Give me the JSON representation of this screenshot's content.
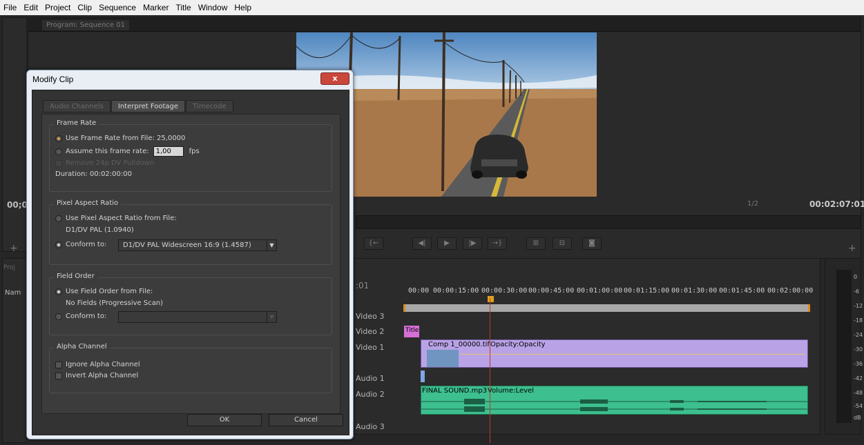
{
  "menu": [
    "File",
    "Edit",
    "Project",
    "Clip",
    "Sequence",
    "Marker",
    "Title",
    "Window",
    "Help"
  ],
  "program_monitor": {
    "tab_label": "Program: Sequence 01",
    "zoom": "1/2",
    "timecode": "00:02:07:01",
    "left_timecode": "00;0"
  },
  "timeline": {
    "playhead_timecode": ":01",
    "ruler": [
      "00:00",
      "00:00:15:00",
      "00:00:30:00",
      "00:00:45:00",
      "00:01:00:00",
      "00:01:15:00",
      "00:01:30:00",
      "00:01:45:00",
      "00:02:00:00"
    ],
    "tracks": [
      "Video 3",
      "Video 2",
      "Video 1",
      "Audio 1",
      "Audio 2",
      "Audio 3"
    ],
    "clips": {
      "title_clip": "Title",
      "video_clip": "Comp 1_00000.tif",
      "video_effect": "Opacity:Opacity",
      "audio_clip": "FINAL SOUND.mp3",
      "audio_effect": "Volume:Level"
    }
  },
  "project_panel": {
    "tab": "Proj",
    "name_header": "Nam"
  },
  "meter": {
    "labels": [
      "0",
      "-6",
      "-12",
      "-18",
      "-24",
      "-30",
      "-36",
      "-42",
      "-48",
      "-54",
      "dB"
    ]
  },
  "dialog": {
    "title": "Modify Clip",
    "close": "x",
    "tabs": [
      "Audio Channels",
      "Interpret Footage",
      "Timecode"
    ],
    "frame_rate": {
      "legend": "Frame Rate",
      "use_file": "Use Frame Rate from File:",
      "file_rate": "25,0000",
      "assume": "Assume this frame rate:",
      "assume_value": "1,00",
      "fps": "fps",
      "remove_pulldown": "Remove 24p DV Pulldown",
      "duration": "Duration:  00:02:00:00"
    },
    "pixel_aspect": {
      "legend": "Pixel Aspect Ratio",
      "use_file": "Use Pixel Aspect Ratio from File:",
      "file_value": "D1/DV PAL (1.0940)",
      "conform": "Conform to:",
      "conform_value": "D1/DV PAL Widescreen 16:9 (1.4587)"
    },
    "field_order": {
      "legend": "Field Order",
      "use_file": "Use Field Order from File:",
      "file_value": "No Fields (Progressive Scan)",
      "conform": "Conform to:"
    },
    "alpha": {
      "legend": "Alpha Channel",
      "ignore": "Ignore Alpha Channel",
      "invert": "Invert Alpha Channel"
    },
    "ok": "OK",
    "cancel": "Cancel"
  }
}
